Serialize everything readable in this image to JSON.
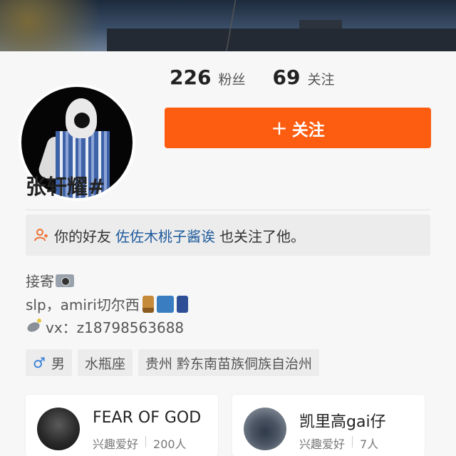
{
  "stats": {
    "followers_count": "226",
    "followers_label": "粉丝",
    "following_count": "69",
    "following_label": "关注"
  },
  "follow_button": {
    "plus": "+",
    "label": "关注"
  },
  "profile": {
    "name": "张轩耀#"
  },
  "friend_notice": {
    "prefix": "你的好友",
    "friend_name": "佐佐木桃子酱诶",
    "suffix": "也关注了他。"
  },
  "bio": {
    "line1": "接寄",
    "line2": "slp，amiri切尔西",
    "line3": "vx：z18798563688"
  },
  "tags": {
    "gender_symbol": "♂",
    "gender": "男",
    "zodiac": "水瓶座",
    "location": "贵州 黔东南苗族侗族自治州"
  },
  "groups": [
    {
      "title": "FEAR OF GOD",
      "category": "兴趣爱好",
      "members": "200人"
    },
    {
      "title": "凯里高gai仔",
      "category": "兴趣爱好",
      "members": "7人"
    }
  ],
  "icons": {
    "camera": "camera-icon",
    "boot": "boot-icon",
    "shirt-tie": "shirt-tie-icon",
    "jeans": "jeans-icon",
    "satellite": "satellite-icon",
    "friend": "friend-icon"
  },
  "colors": {
    "accent": "#fd5d10",
    "link": "#1e5a9c",
    "gender": "#2f7bd8"
  }
}
